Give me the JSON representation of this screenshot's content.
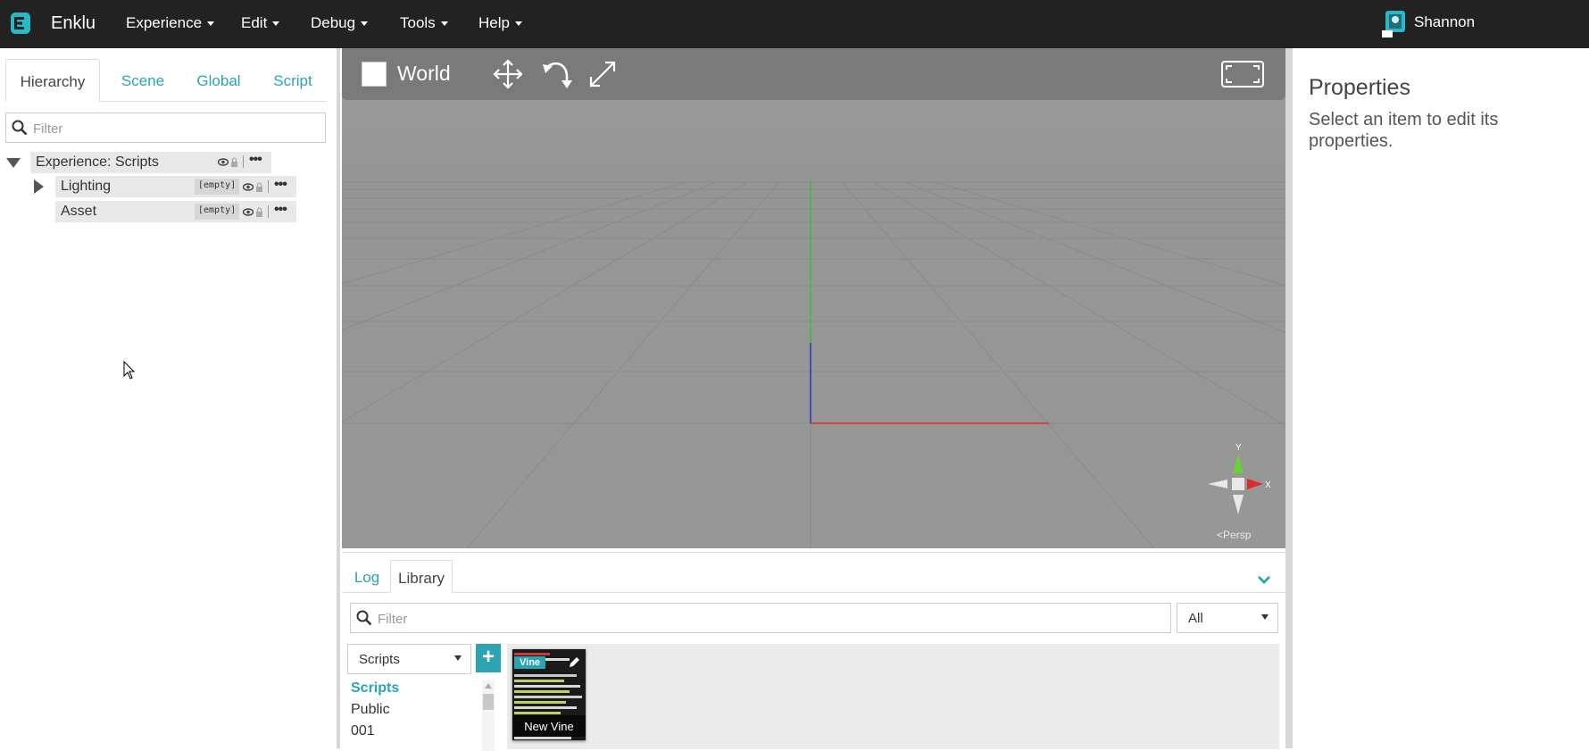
{
  "app": {
    "brand": "Enklu",
    "nav": [
      {
        "label": "Experience"
      },
      {
        "label": "Edit"
      },
      {
        "label": "Debug"
      },
      {
        "label": "Tools"
      },
      {
        "label": "Help"
      }
    ],
    "user": "Shannon",
    "accent_color": "#2aa3b3"
  },
  "left_panel": {
    "tabs": [
      "Hierarchy",
      "Scene",
      "Global",
      "Script"
    ],
    "active_tab": "Hierarchy",
    "filter_placeholder": "Filter",
    "tree": {
      "root": {
        "label": "Experience: Scripts",
        "expanded": true
      },
      "children": [
        {
          "label": "Lighting",
          "tag": "[empty]",
          "expandable": true
        },
        {
          "label": "Asset",
          "tag": "[empty]",
          "expandable": false
        }
      ]
    }
  },
  "viewport": {
    "world_label": "World",
    "tools": [
      "move-icon",
      "rotate-icon",
      "scale-icon"
    ],
    "gizmo": {
      "y": "Y",
      "x": "X"
    },
    "camera_mode": "Persp",
    "background_color": "#9a9a9a"
  },
  "properties": {
    "title": "Properties",
    "hint": "Select an item to edit its properties."
  },
  "bottom_panel": {
    "tabs": [
      "Log",
      "Library"
    ],
    "active_tab": "Library",
    "filter_placeholder": "Filter",
    "type_filter": "All",
    "folder_select": "Scripts",
    "add_label": "+",
    "folders": [
      {
        "label": "Scripts",
        "active": true
      },
      {
        "label": "Public",
        "active": false
      },
      {
        "label": "001",
        "active": false
      }
    ],
    "items": [
      {
        "badge": "Vine",
        "name": "New Vine"
      }
    ]
  }
}
